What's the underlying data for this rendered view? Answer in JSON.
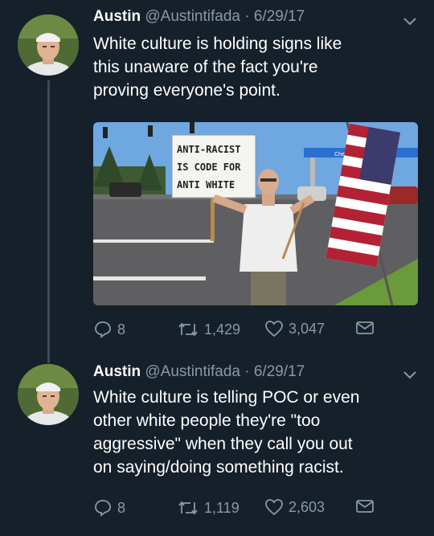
{
  "tweets": [
    {
      "display_name": "Austin",
      "meta": "@Austintifada · 6/29/17",
      "lines": [
        "White culture is holding signs like",
        "this unaware of the fact you're",
        "proving everyone's point."
      ],
      "photo_sign": [
        "ANTI-RACIST",
        "IS CODE FOR",
        "ANTI WHITE"
      ],
      "photo_station": "Chevron",
      "replies": "8",
      "retweets": "1,429",
      "likes": "3,047"
    },
    {
      "display_name": "Austin",
      "meta": "@Austintifada · 6/29/17",
      "lines": [
        "White culture is telling POC or even",
        "other white people they're \"too",
        "aggressive\" when they call you out",
        "on saying/doing something racist."
      ],
      "replies": "8",
      "retweets": "1,119",
      "likes": "2,603"
    }
  ],
  "icons": {
    "reply": "reply-icon",
    "retweet": "retweet-icon",
    "like": "heart-icon",
    "dm": "envelope-icon",
    "menu": "chevron-down-icon"
  },
  "colors": {
    "background": "#16202b",
    "secondary_text": "#8899a6",
    "thread_line": "#3d4a57"
  }
}
